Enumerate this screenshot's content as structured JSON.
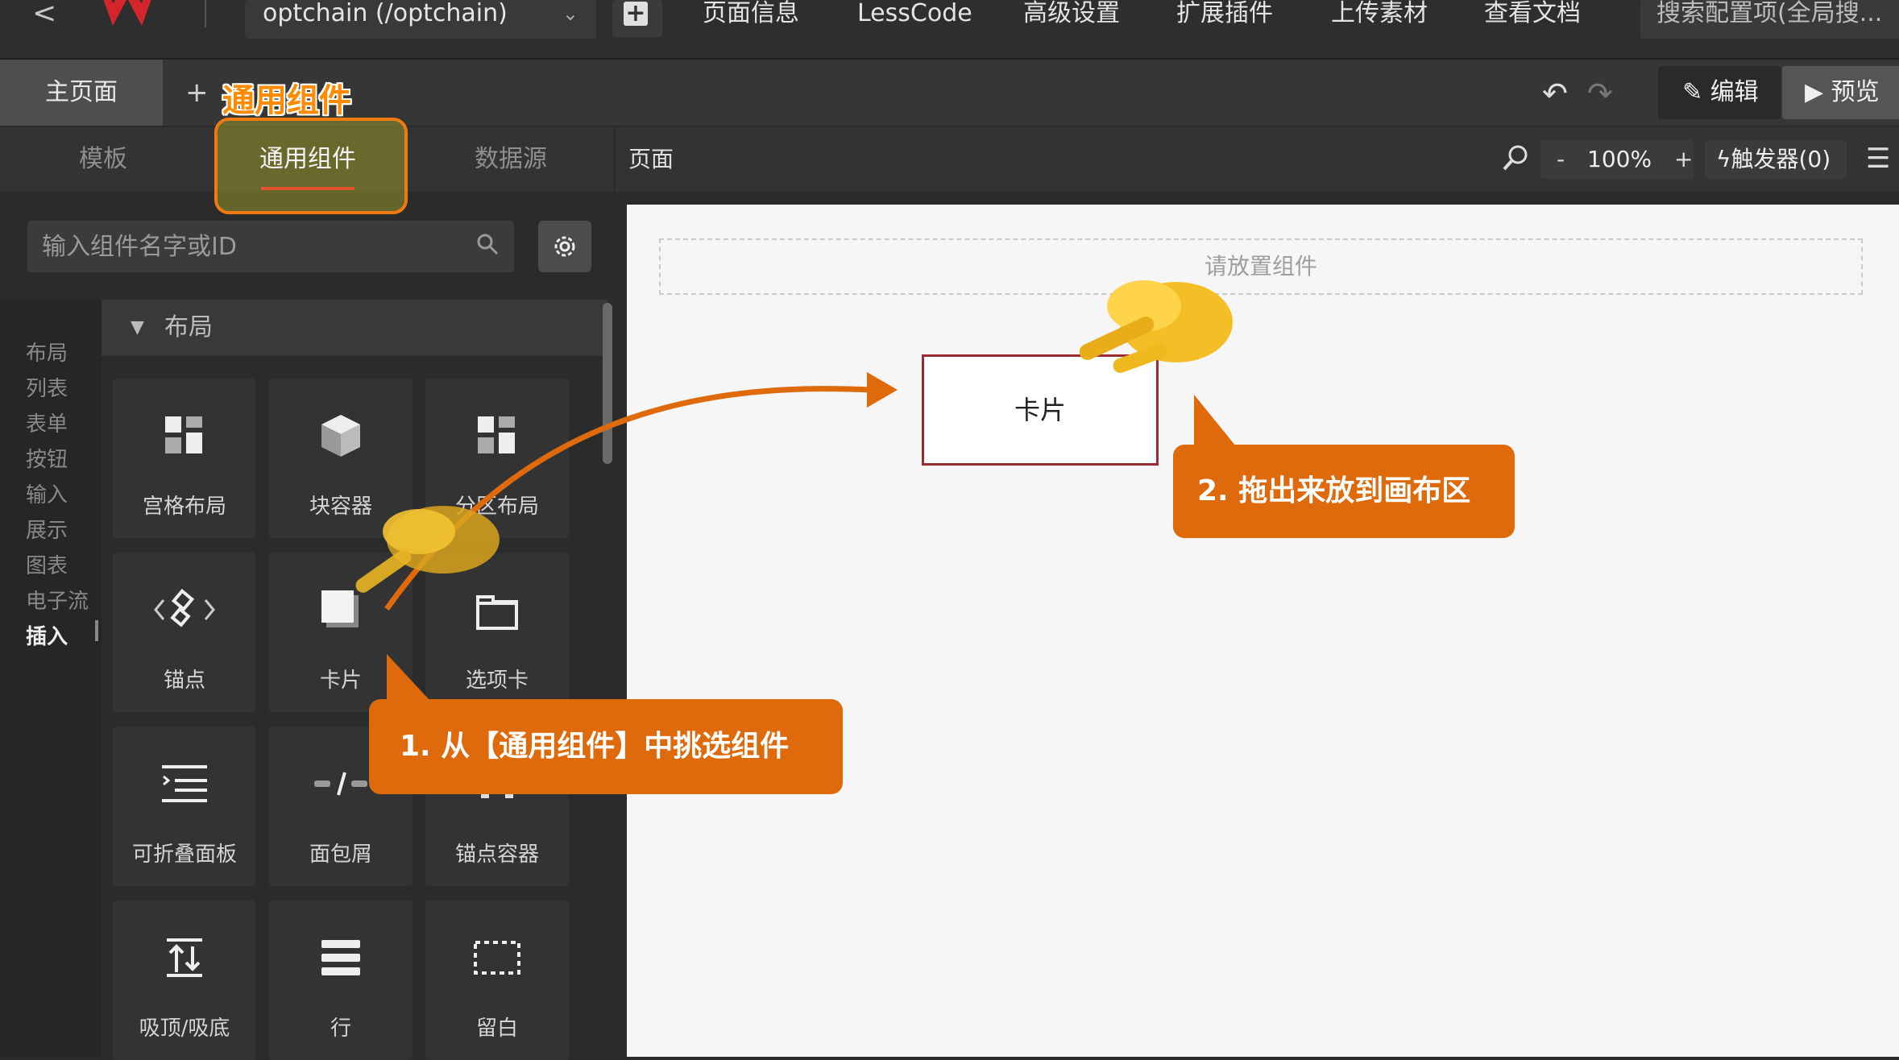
{
  "topbar": {
    "back": "<",
    "app_select": "optchain (/optchain)",
    "add_page": "+",
    "menu": [
      "页面信息",
      "LessCode",
      "高级设置",
      "扩展插件",
      "上传素材",
      "查看文档"
    ],
    "search": "搜索配置项(全局搜..."
  },
  "tabbar": {
    "home_tab": "主页面",
    "add": "+",
    "annotation": "通用组件",
    "edit": "编辑",
    "preview": "预览"
  },
  "panel": {
    "tabs": [
      "模板",
      "通用组件",
      "数据源"
    ],
    "search_placeholder": "输入组件名字或ID",
    "categories": [
      "布局",
      "列表",
      "表单",
      "按钮",
      "输入",
      "展示",
      "图表",
      "电子流",
      "插入"
    ],
    "group_title": "布局",
    "components": [
      {
        "label": "宫格布局",
        "icon": "grid-layout-icon"
      },
      {
        "label": "块容器",
        "icon": "block-container-icon"
      },
      {
        "label": "分区布局",
        "icon": "section-layout-icon"
      },
      {
        "label": "锚点",
        "icon": "anchor-icon"
      },
      {
        "label": "卡片",
        "icon": "card-icon"
      },
      {
        "label": "选项卡",
        "icon": "tabs-icon"
      },
      {
        "label": "可折叠面板",
        "icon": "collapse-panel-icon"
      },
      {
        "label": "面包屑",
        "icon": "breadcrumb-icon"
      },
      {
        "label": "锚点容器",
        "icon": "anchor-container-icon"
      },
      {
        "label": "吸顶/吸底",
        "icon": "sticky-icon"
      },
      {
        "label": "行",
        "icon": "row-icon"
      },
      {
        "label": "留白",
        "icon": "spacer-icon"
      }
    ]
  },
  "canvas": {
    "title": "页面",
    "zoom_minus": "-",
    "zoom": "100%",
    "zoom_plus": "+",
    "trigger": "触发器(0)",
    "drop_hint": "请放置组件",
    "dropped_card": "卡片"
  },
  "callouts": {
    "step1": "1. 从【通用组件】中挑选组件",
    "step2": "2. 拖出来放到画布区"
  },
  "colors": {
    "accent_orange": "#de6a0c",
    "card_border": "#9c2a35",
    "tab_underline": "#e0542e"
  }
}
